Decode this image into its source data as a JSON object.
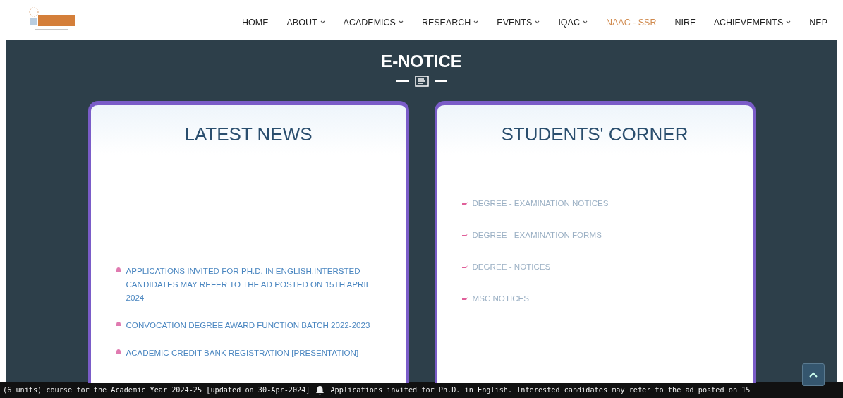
{
  "nav": {
    "items": [
      {
        "label": "HOME",
        "dropdown": false,
        "selected": false
      },
      {
        "label": "ABOUT",
        "dropdown": true,
        "selected": false
      },
      {
        "label": "ACADEMICS",
        "dropdown": true,
        "selected": false
      },
      {
        "label": "RESEARCH",
        "dropdown": true,
        "selected": false
      },
      {
        "label": "EVENTS",
        "dropdown": true,
        "selected": false
      },
      {
        "label": "IQAC",
        "dropdown": true,
        "selected": false
      },
      {
        "label": "NAAC - SSR",
        "dropdown": false,
        "selected": true
      },
      {
        "label": "NIRF",
        "dropdown": false,
        "selected": false
      },
      {
        "label": "ACHIEVEMENTS",
        "dropdown": true,
        "selected": false
      },
      {
        "label": "NEP",
        "dropdown": false,
        "selected": false
      }
    ]
  },
  "section": {
    "title": "E-NOTICE"
  },
  "cards": [
    {
      "title": "LATEST NEWS",
      "kind": "news",
      "items": [
        "APPLICATIONS INVITED FOR PH.D. IN ENGLISH.INTERSTED CANDIDATES MAY REFER TO THE AD POSTED ON 15TH APRIL 2024",
        "CONVOCATION DEGREE AWARD FUNCTION BATCH 2022-2023",
        "ACADEMIC CREDIT BANK REGISTRATION [PRESENTATION]"
      ]
    },
    {
      "title": "STUDENTS' CORNER",
      "kind": "links",
      "items": [
        "DEGREE - EXAMINATION NOTICES",
        "DEGREE - EXAMINATION FORMS",
        "DEGREE - NOTICES",
        "MSC NOTICES"
      ]
    }
  ],
  "ticker": {
    "parts": [
      "(6 units) course for the Academic Year 2024-25 [updated on 30-Apr-2024]",
      "Applications invited for Ph.D. in English. Interested candidates may refer to the ad posted on 15"
    ]
  }
}
